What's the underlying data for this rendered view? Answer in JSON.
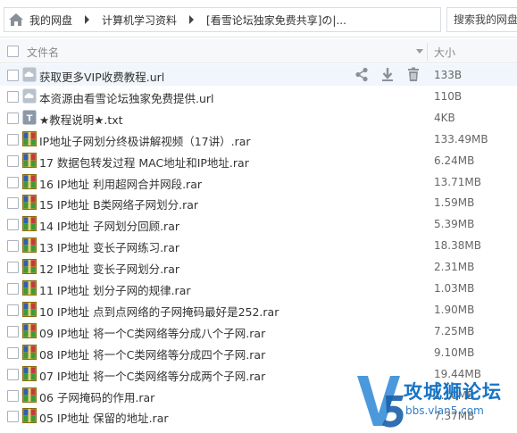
{
  "breadcrumb": {
    "items": [
      "我的网盘",
      "计算机学习资料",
      "[看雪论坛独家免费共享]の|..."
    ]
  },
  "search": {
    "label": "搜索我的网盘"
  },
  "table": {
    "col_name": "文件名",
    "col_size": "大小"
  },
  "files": [
    {
      "name": "获取更多VIP收费教程.url",
      "size": "133B",
      "type": "url"
    },
    {
      "name": "本资源由看雪论坛独家免费提供.url",
      "size": "110B",
      "type": "url"
    },
    {
      "name": "★教程说明★.txt",
      "size": "4KB",
      "type": "txt"
    },
    {
      "name": "IP地址子网划分终极讲解视频（17讲）.rar",
      "size": "133.49MB",
      "type": "rar"
    },
    {
      "name": "17 数据包转发过程 MAC地址和IP地址.rar",
      "size": "6.24MB",
      "type": "rar"
    },
    {
      "name": "16 IP地址 利用超网合并网段.rar",
      "size": "13.71MB",
      "type": "rar"
    },
    {
      "name": "15 IP地址 B类网络子网划分.rar",
      "size": "1.59MB",
      "type": "rar"
    },
    {
      "name": "14 IP地址 子网划分回顾.rar",
      "size": "5.39MB",
      "type": "rar"
    },
    {
      "name": "13 IP地址 变长子网练习.rar",
      "size": "18.38MB",
      "type": "rar"
    },
    {
      "name": "12 IP地址 变长子网划分.rar",
      "size": "2.31MB",
      "type": "rar"
    },
    {
      "name": "11 IP地址 划分子网的规律.rar",
      "size": "1.03MB",
      "type": "rar"
    },
    {
      "name": "10 IP地址 点到点网络的子网掩码最好是252.rar",
      "size": "1.90MB",
      "type": "rar"
    },
    {
      "name": "09 IP地址 将一个C类网络等分成八个子网.rar",
      "size": "7.25MB",
      "type": "rar"
    },
    {
      "name": "08 IP地址 将一个C类网络等分成四个子网.rar",
      "size": "9.10MB",
      "type": "rar"
    },
    {
      "name": "07 IP地址 将一个C类网络等分成两个子网.rar",
      "size": "19.44MB",
      "type": "rar"
    },
    {
      "name": "06 子网掩码的作用.rar",
      "size": "1.10MB",
      "type": "rar"
    },
    {
      "name": "05 IP地址 保留的地址.rar",
      "size": "7.37MB",
      "type": "rar"
    }
  ],
  "row_actions": [
    "share-icon",
    "download-icon",
    "delete-icon"
  ],
  "watermark": {
    "text": "攻城狮论坛",
    "url": "bbs.vlan5.com"
  },
  "colors": {
    "accent": "#1774c5",
    "hover_row": "#f1f6fc",
    "header_bg": "#f7f8fa"
  }
}
